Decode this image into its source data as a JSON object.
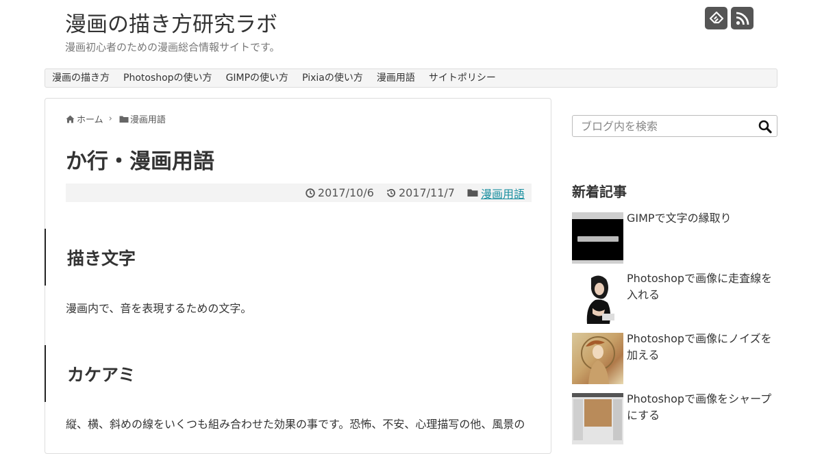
{
  "header": {
    "site_title": "漫画の描き方研究ラボ",
    "site_description": "漫画初心者のための漫画総合情報サイトです。",
    "feedly_icon": "feedly-icon",
    "rss_icon": "rss-icon"
  },
  "nav": {
    "items": [
      {
        "label": "漫画の描き方"
      },
      {
        "label": "Photoshopの使い方"
      },
      {
        "label": "GIMPの使い方"
      },
      {
        "label": "Pixiaの使い方"
      },
      {
        "label": "漫画用語"
      },
      {
        "label": "サイトポリシー"
      }
    ]
  },
  "breadcrumb": {
    "home": "ホーム",
    "category": "漫画用語"
  },
  "article": {
    "title": "か行・漫画用語",
    "published": "2017/10/6",
    "updated": "2017/11/7",
    "category": "漫画用語",
    "sections": [
      {
        "heading": "描き文字",
        "body": "漫画内で、音を表現するための文字。"
      },
      {
        "heading": "カケアミ",
        "body": "縦、横、斜めの線をいくつも組み合わせた効果の事です。恐怖、不安、心理描写の他、風景の"
      }
    ]
  },
  "sidebar": {
    "search": {
      "placeholder": "ブログ内を検索"
    },
    "recent_heading": "新着記事",
    "recent_posts": [
      {
        "title": "GIMPで文字の縁取り"
      },
      {
        "title": "Photoshopで画像に走査線を入れる"
      },
      {
        "title": "Photoshopで画像にノイズを加える"
      },
      {
        "title": "Photoshopで画像をシャープにする"
      }
    ]
  },
  "colors": {
    "link": "#1a8fa0",
    "icon_bg": "#555555",
    "nav_bg": "#f5f5f5",
    "meta_bg": "#f3f3f3"
  }
}
